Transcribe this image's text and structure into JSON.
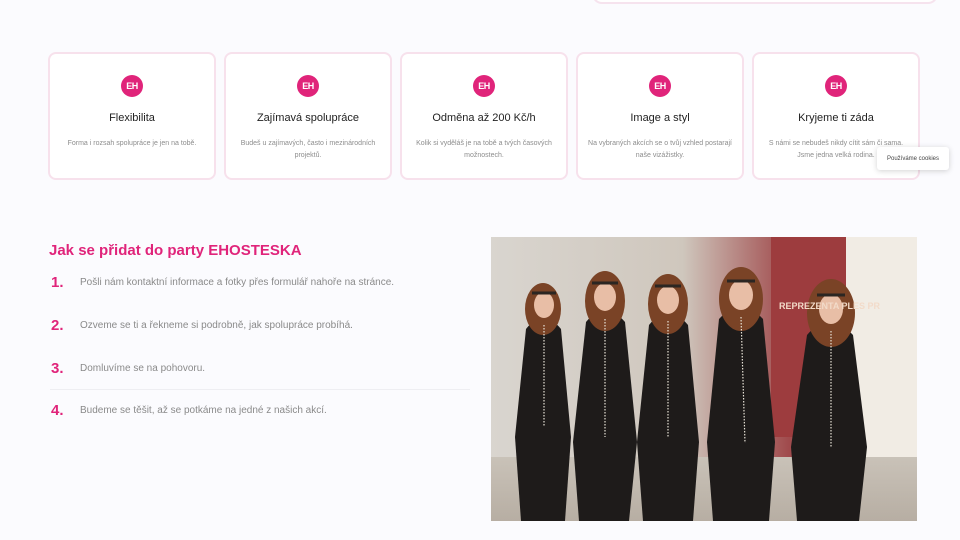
{
  "features": [
    {
      "icon": "eh-logo-icon",
      "badge": "EH",
      "title": "Flexibilita",
      "desc": "Forma i rozsah spolupráce je jen na tobě."
    },
    {
      "icon": "eh-logo-icon",
      "badge": "EH",
      "title": "Zajímavá spolupráce",
      "desc": "Budeš u zajímavých, často i mezinárodních projektů."
    },
    {
      "icon": "eh-logo-icon",
      "badge": "EH",
      "title": "Odměna až 200 Kč/h",
      "desc": "Kolik si vyděláš je na tobě a tvých časových možnostech."
    },
    {
      "icon": "eh-logo-icon",
      "badge": "EH",
      "title": "Image a styl",
      "desc": "Na vybraných akcích se o tvůj vzhled postarají naše vizážistky."
    },
    {
      "icon": "eh-logo-icon",
      "badge": "EH",
      "title": "Kryjeme ti záda",
      "desc": "S námi se nebudeš nikdy cítit sám či sama. Jsme jedna velká rodina."
    }
  ],
  "cookie": {
    "label": "Používáme cookies"
  },
  "steps": {
    "title": "Jak se přidat do party EHOSTESKA",
    "items": [
      {
        "num": "1.",
        "text": "Pošli nám kontaktní informace a fotky přes formulář nahoře na stránce."
      },
      {
        "num": "2.",
        "text": "Ozveme se ti a řekneme si podrobně, jak spolupráce probíhá."
      },
      {
        "num": "3.",
        "text": "Domluvíme se na pohovoru."
      },
      {
        "num": "4.",
        "text": "Budeme se těšit, až se potkáme na jedné z našich akcí."
      }
    ]
  },
  "photo": {
    "poster_text": "REPREZENTA PLES PR"
  },
  "colors": {
    "accent": "#e0247a",
    "card_border": "#f7e1ec",
    "background": "#fbfbfe"
  }
}
